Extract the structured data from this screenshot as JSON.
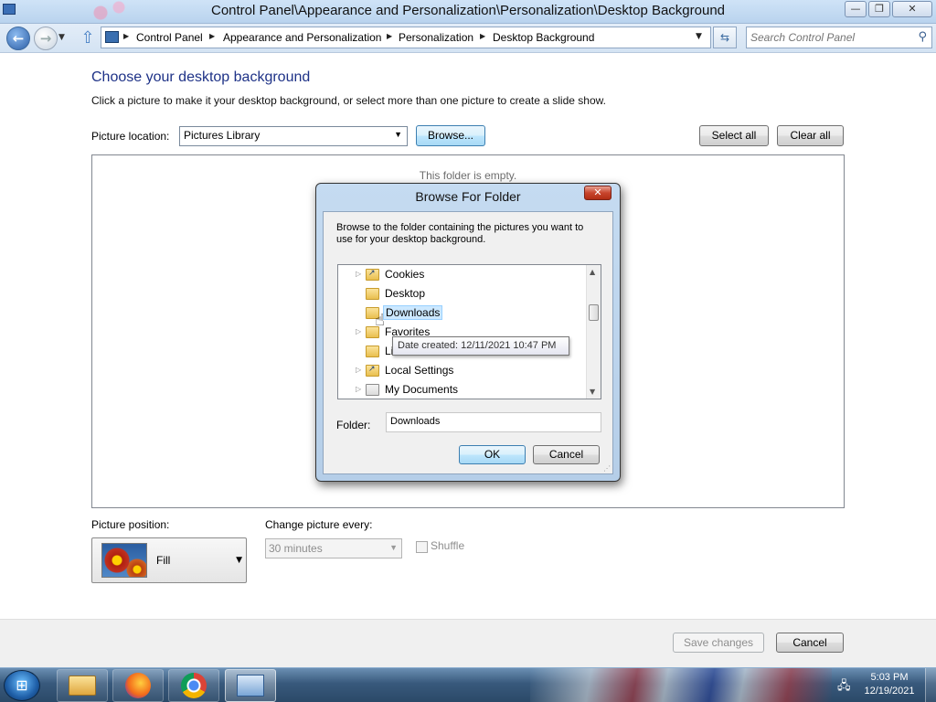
{
  "window": {
    "title": "Control Panel\\Appearance and Personalization\\Personalization\\Desktop Background",
    "controls": {
      "minimize": "—",
      "restore": "❐",
      "close": "✕"
    }
  },
  "address": {
    "breadcrumbs": [
      "Control Panel",
      "Appearance and Personalization",
      "Personalization",
      "Desktop Background"
    ],
    "search_placeholder": "Search Control Panel"
  },
  "main": {
    "heading": "Choose your desktop background",
    "subheading": "Click a picture to make it your desktop background, or select more than one picture to create a slide show.",
    "picture_location_label": "Picture location:",
    "picture_location_value": "Pictures Library",
    "browse_label": "Browse...",
    "select_all_label": "Select all",
    "clear_all_label": "Clear all",
    "empty_message": "This folder is empty.",
    "picture_position_label": "Picture position:",
    "picture_position_value": "Fill",
    "change_picture_label": "Change picture every:",
    "change_picture_value": "30 minutes",
    "shuffle_label": "Shuffle",
    "save_label": "Save changes",
    "cancel_label": "Cancel"
  },
  "dialog": {
    "title": "Browse For Folder",
    "close": "✕",
    "instructions": "Browse to the folder containing the pictures you want to use for your desktop background.",
    "tree": [
      {
        "label": "Cookies",
        "expandable": true,
        "icon": "shortcut-folder-icon"
      },
      {
        "label": "Desktop",
        "expandable": false,
        "icon": "folder-icon"
      },
      {
        "label": "Downloads",
        "expandable": false,
        "icon": "folder-icon",
        "selected": true
      },
      {
        "label": "Favorites",
        "expandable": true,
        "icon": "favorites-folder-icon"
      },
      {
        "label": "Li",
        "expandable": false,
        "icon": "library-folder-icon"
      },
      {
        "label": "Local Settings",
        "expandable": true,
        "icon": "shortcut-folder-icon"
      },
      {
        "label": "My Documents",
        "expandable": true,
        "icon": "documents-folder-icon"
      }
    ],
    "tooltip": "Date created: 12/11/2021 10:47 PM",
    "folder_label": "Folder:",
    "folder_value": "Downloads",
    "ok_label": "OK",
    "cancel_label": "Cancel"
  },
  "taskbar": {
    "start_icon": "windows-logo",
    "apps": [
      "windows-explorer",
      "firefox",
      "chrome",
      "control-panel"
    ],
    "time": "5:03 PM",
    "date": "12/19/2021"
  }
}
